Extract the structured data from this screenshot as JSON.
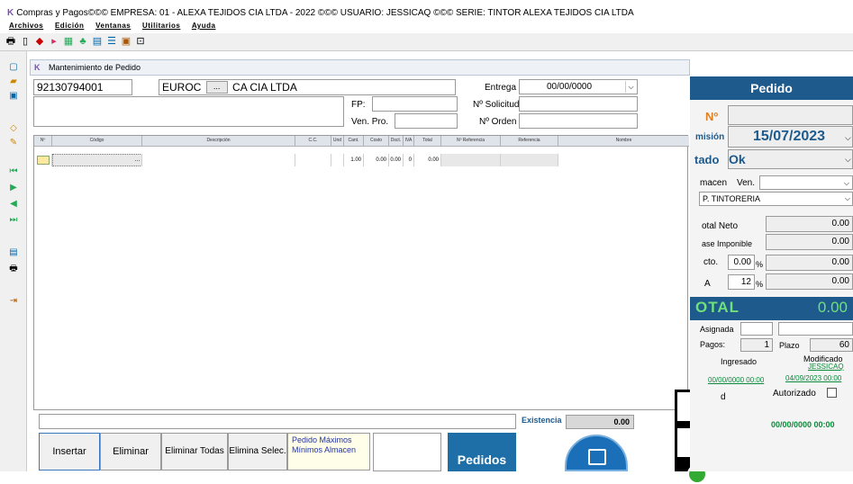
{
  "window": {
    "title": "Compras y Pagos©©© EMPRESA: 01 - ALEXA TEJIDOS CIA LTDA - 2022 ©©©  USUARIO: JESSICAQ ©©© SERIE: TINTOR ALEXA TEJIDOS CIA LTDA"
  },
  "menu": [
    "Archivos",
    "Edición",
    "Ventanas",
    "Utilitarios",
    "Ayuda"
  ],
  "form": {
    "title": "Mantenimiento de Pedido",
    "ruc": "92130794001",
    "provider": "EUROC",
    "provider_suffix": "CA CIA LTDA",
    "ellipsis": "...",
    "entrega_label": "Entrega",
    "entrega_value": "00/00/0000",
    "fp_label": "FP:",
    "solicitud_label": "Nº Solicitud",
    "venpro_label": "Ven. Pro.",
    "orden_label": "Nº Orden"
  },
  "grid": {
    "headers": [
      "Nº",
      "Código",
      "Descripción",
      "C.C.",
      "Und",
      "Cant.",
      "Costo",
      "Dsct.",
      "IVA",
      "Total",
      "Nº Referencia",
      "Referencia",
      "Nombre"
    ],
    "row": {
      "cant": "1.00",
      "costo": "0.00",
      "dsct": "0.00",
      "iva": "0",
      "total": "0.00"
    }
  },
  "bottom": {
    "existencia_label": "Existencia",
    "existencia_value": "0.00",
    "buttons": {
      "insertar": "Insertar",
      "eliminar": "Eliminar",
      "eliminar_todas": "Eliminar Todas",
      "elimina_selec": "Elimina Selec.",
      "pedido_max": "Pedido Máximos Mínimos Almacen",
      "pedidos": "Pedidos"
    }
  },
  "panel": {
    "title": "Pedido",
    "no_label": "Nº",
    "emision_label": "misión",
    "emision_value": "15/07/2023",
    "estado_label": "tado",
    "estado_value": "Ok",
    "almacen_label": "macen",
    "ven_label": "Ven.",
    "almacen_value": "P. TINTORERIA",
    "total_neto_label": "otal Neto",
    "total_neto": "0.00",
    "base_label": "ase Imponible",
    "base": "0.00",
    "dcto_label": "cto.",
    "dcto_pct": "0.00",
    "pct": "%",
    "dcto": "0.00",
    "iva_label": "A",
    "iva_pct": "12",
    "iva": "0.00",
    "total_label": "OTAL",
    "total": "0.00",
    "asignada_label": "Asignada",
    "pagos_label": "Pagos:",
    "pagos_value": "1",
    "plazo_label": "Plazo",
    "plazo_value": "60",
    "ingresado_label": "Ingresado",
    "modificado_label": "Modificado",
    "modificado_user": "JESSICAQ",
    "ingresado_date": "00/00/0000 00:00",
    "modificado_date": "04/09/2023 00:00",
    "d_label": "d",
    "autorizado_label": "Autorizado",
    "autorizado_date": "00/00/0000 00:00"
  },
  "colors": {
    "accent": "#1e5a8c",
    "green": "#0a8a3a",
    "brand": "#7b4fb0"
  }
}
